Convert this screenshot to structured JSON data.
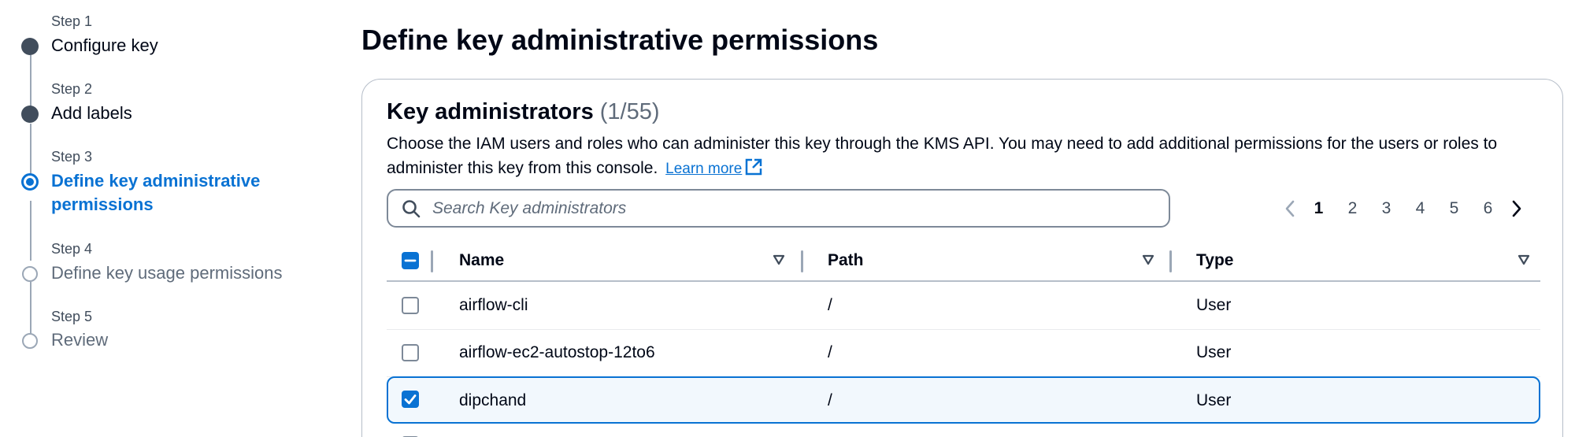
{
  "steps": [
    {
      "num": "Step 1",
      "title": "Configure key",
      "state": "done"
    },
    {
      "num": "Step 2",
      "title": "Add labels",
      "state": "done"
    },
    {
      "num": "Step 3",
      "title": "Define key administrative permissions",
      "state": "current"
    },
    {
      "num": "Step 4",
      "title": "Define key usage permissions",
      "state": "pending"
    },
    {
      "num": "Step 5",
      "title": "Review",
      "state": "pending"
    }
  ],
  "page_title": "Define key administrative permissions",
  "section": {
    "title": "Key administrators",
    "count": "(1/55)",
    "description": "Choose the IAM users and roles who can administer this key through the KMS API. You may need to add additional permissions for the users or roles to administer this key from this console.",
    "learn_more": "Learn more"
  },
  "search": {
    "placeholder": "Search Key administrators"
  },
  "pagination": {
    "pages": [
      "1",
      "2",
      "3",
      "4",
      "5",
      "6"
    ],
    "current": "1"
  },
  "table": {
    "columns": [
      "Name",
      "Path",
      "Type"
    ],
    "rows": [
      {
        "name": "airflow-cli",
        "path": "/",
        "type": "User",
        "checked": false
      },
      {
        "name": "airflow-ec2-autostop-12to6",
        "path": "/",
        "type": "User",
        "checked": false
      },
      {
        "name": "dipchand",
        "path": "/",
        "type": "User",
        "checked": true
      }
    ]
  },
  "colors": {
    "accent": "#0972d3",
    "done_step": "#414d5c",
    "text": "#000716",
    "muted": "#5f6b7a"
  }
}
